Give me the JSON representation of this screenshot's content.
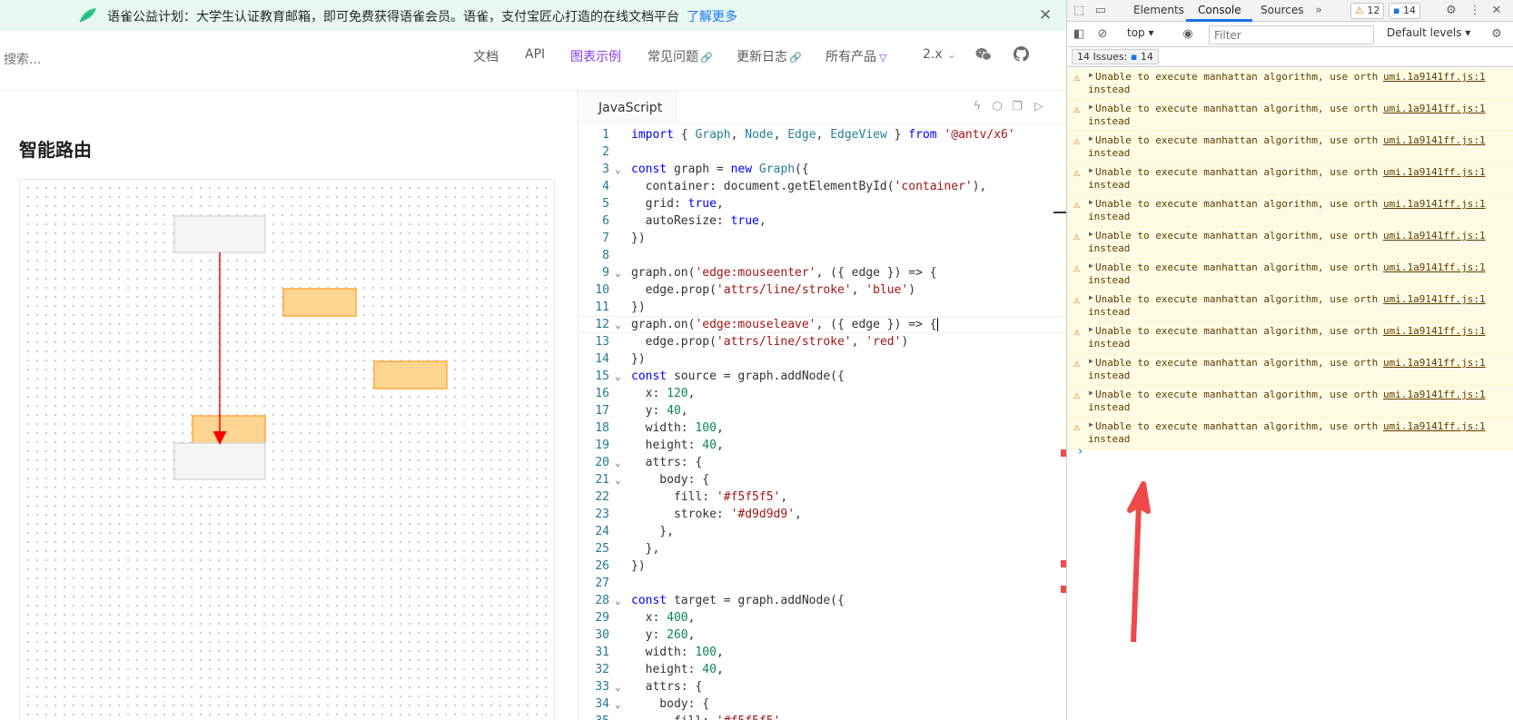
{
  "banner": {
    "text": "语雀公益计划：大学生认证教育邮箱，即可免费获得语雀会员。语雀，支付宝匠心打造的在线文档平台",
    "link": "了解更多",
    "close": "✕"
  },
  "nav": {
    "search_placeholder": "搜索...",
    "items": [
      "文档",
      "API",
      "图表示例",
      "常见问题",
      "更新日志",
      "所有产品",
      "2.x"
    ],
    "active": "图表示例"
  },
  "page": {
    "title": "智能路由"
  },
  "graph": {
    "nodes": [
      {
        "role": "source",
        "fill": "#f5f5f5",
        "stroke": "#d9d9d9"
      },
      {
        "role": "obstacle",
        "fill": "#ffd591",
        "stroke": "#ffa940"
      },
      {
        "role": "obstacle",
        "fill": "#ffd591",
        "stroke": "#ffa940"
      },
      {
        "role": "obstacle",
        "fill": "#ffd591",
        "stroke": "#ffa940"
      },
      {
        "role": "target",
        "fill": "#f5f5f5",
        "stroke": "#d9d9d9"
      }
    ],
    "edge_color": "#ff0000"
  },
  "editor": {
    "tab": "JavaScript",
    "cursor_line": 12,
    "lines": [
      "import { Graph, Node, Edge, EdgeView } from '@antv/x6'",
      "",
      "const graph = new Graph({",
      "  container: document.getElementById('container'),",
      "  grid: true,",
      "  autoResize: true,",
      "})",
      "",
      "graph.on('edge:mouseenter', ({ edge }) => {",
      "  edge.prop('attrs/line/stroke', 'blue')",
      "})",
      "graph.on('edge:mouseleave', ({ edge }) => {",
      "  edge.prop('attrs/line/stroke', 'red')",
      "})",
      "const source = graph.addNode({",
      "  x: 120,",
      "  y: 40,",
      "  width: 100,",
      "  height: 40,",
      "  attrs: {",
      "    body: {",
      "      fill: '#f5f5f5',",
      "      stroke: '#d9d9d9',",
      "    },",
      "  },",
      "})",
      "",
      "const target = graph.addNode({",
      "  x: 400,",
      "  y: 260,",
      "  width: 100,",
      "  height: 40,",
      "  attrs: {",
      "    body: {",
      "      fill: '#f5f5f5',"
    ],
    "fold_lines": [
      3,
      9,
      12,
      15,
      20,
      21,
      28,
      33,
      34
    ]
  },
  "devtools": {
    "tabs": [
      "Elements",
      "Console",
      "Sources"
    ],
    "active_tab": "Console",
    "warn_count": "12",
    "info_count": "14",
    "context": "top",
    "filter_placeholder": "Filter",
    "levels": "Default levels",
    "issues_label": "14 Issues:",
    "issues_count": "14",
    "messages": [
      {
        "line1": "Unable to execute manhattan algorithm, use orth",
        "line2": "instead",
        "source": "umi.1a9141ff.js:1"
      },
      {
        "line1": "Unable to execute manhattan algorithm, use orth",
        "line2": "instead",
        "source": "umi.1a9141ff.js:1"
      },
      {
        "line1": "Unable to execute manhattan algorithm, use orth",
        "line2": "instead",
        "source": "umi.1a9141ff.js:1"
      },
      {
        "line1": "Unable to execute manhattan algorithm, use orth",
        "line2": "instead",
        "source": "umi.1a9141ff.js:1"
      },
      {
        "line1": "Unable to execute manhattan algorithm, use orth",
        "line2": "instead",
        "source": "umi.1a9141ff.js:1"
      },
      {
        "line1": "Unable to execute manhattan algorithm, use orth",
        "line2": "instead",
        "source": "umi.1a9141ff.js:1"
      },
      {
        "line1": "Unable to execute manhattan algorithm, use orth",
        "line2": "instead",
        "source": "umi.1a9141ff.js:1"
      },
      {
        "line1": "Unable to execute manhattan algorithm, use orth",
        "line2": "instead",
        "source": "umi.1a9141ff.js:1"
      },
      {
        "line1": "Unable to execute manhattan algorithm, use orth",
        "line2": "instead",
        "source": "umi.1a9141ff.js:1"
      },
      {
        "line1": "Unable to execute manhattan algorithm, use orth",
        "line2": "instead",
        "source": "umi.1a9141ff.js:1"
      },
      {
        "line1": "Unable to execute manhattan algorithm, use orth",
        "line2": "instead",
        "source": "umi.1a9141ff.js:1"
      },
      {
        "line1": "Unable to execute manhattan algorithm, use orth",
        "line2": "instead",
        "source": "umi.1a9141ff.js:1"
      }
    ],
    "prompt": "›"
  },
  "colors": {
    "accent": "#873bf4",
    "banner_bg": "#e8f7f1",
    "warning_bg": "#fffbe5",
    "annotation_arrow": "#f04848"
  }
}
